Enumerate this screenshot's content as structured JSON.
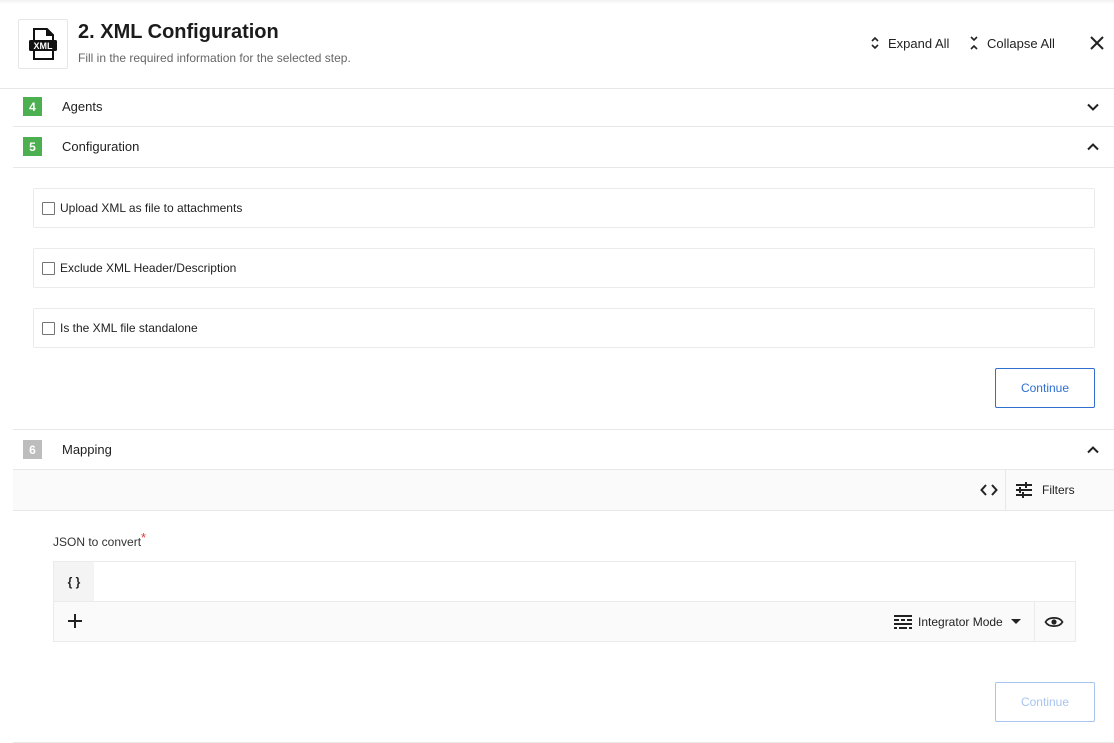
{
  "header": {
    "icon": "xml-file-icon",
    "title": "2. XML Configuration",
    "subtitle": "Fill in the required information for the selected step.",
    "expand_all": "Expand All",
    "collapse_all": "Collapse All",
    "close_icon": "close-icon"
  },
  "sections": [
    {
      "number": "4",
      "label": "Agents",
      "state": "collapsed",
      "badge_color": "#4caf50"
    },
    {
      "number": "5",
      "label": "Configuration",
      "state": "expanded",
      "badge_color": "#4caf50"
    },
    {
      "number": "6",
      "label": "Mapping",
      "state": "expanded",
      "badge_color": "#bdbdbd"
    }
  ],
  "configuration": {
    "options": [
      {
        "label": "Upload XML as file to attachments",
        "checked": false
      },
      {
        "label": "Exclude XML Header/Description",
        "checked": false
      },
      {
        "label": "Is the XML file standalone",
        "checked": false
      }
    ],
    "continue_label": "Continue"
  },
  "mapping": {
    "toolbar": {
      "code_toggle_icon": "code-icon",
      "filters_label": "Filters"
    },
    "field": {
      "label": "JSON to convert",
      "required_mark": "*",
      "type_glyph": "{ }",
      "value": "",
      "mode_label": "Integrator Mode"
    },
    "continue_label": "Continue",
    "continue_enabled": false
  },
  "colors": {
    "accent": "#2f6fd0",
    "accent_disabled": "#a8c4ef",
    "step_done": "#4caf50",
    "step_pending": "#bdbdbd",
    "required": "#e53935"
  }
}
